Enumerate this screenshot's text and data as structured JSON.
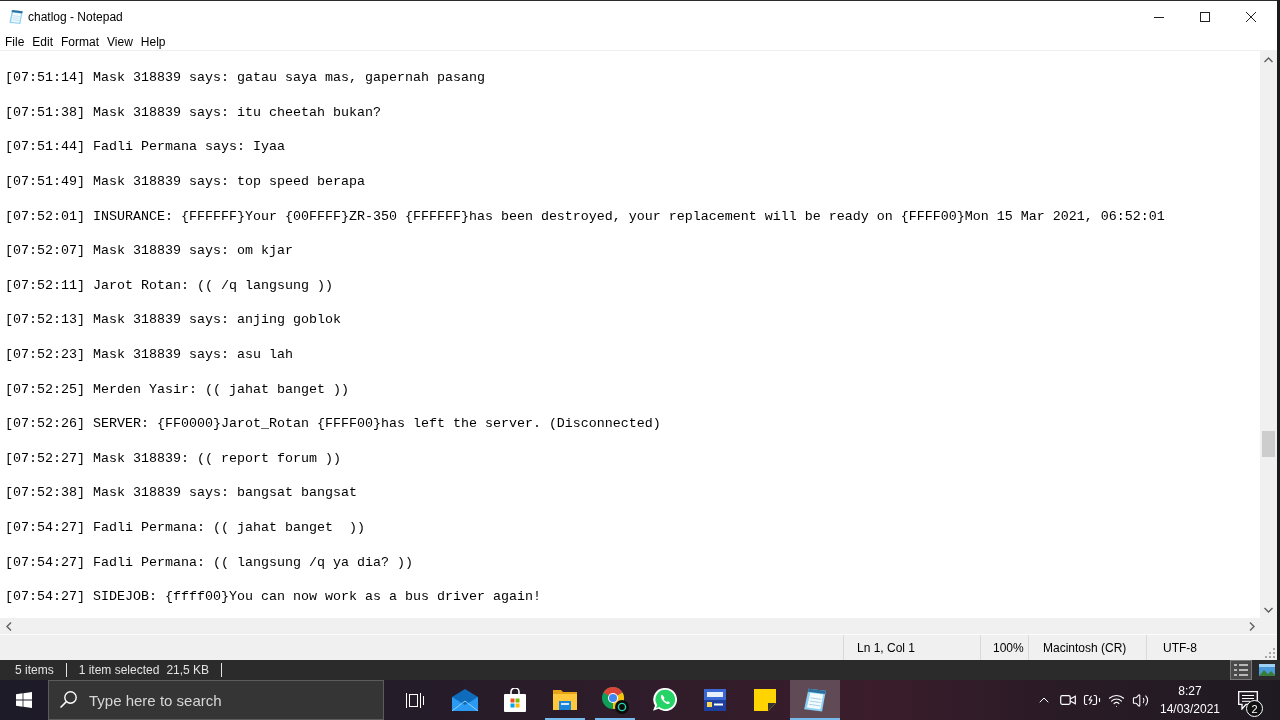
{
  "window": {
    "title": "chatlog - Notepad"
  },
  "menu": [
    "File",
    "Edit",
    "Format",
    "View",
    "Help"
  ],
  "lines": [
    "[07:51:14] Mask 318839 says: gatau saya mas, gapernah pasang",
    "[07:51:38] Mask 318839 says: itu cheetah bukan?",
    "[07:51:44] Fadli Permana says: Iyaa",
    "[07:51:49] Mask 318839 says: top speed berapa",
    "[07:52:01] INSURANCE: {FFFFFF}Your {00FFFF}ZR-350 {FFFFFF}has been destroyed, your replacement will be ready on {FFFF00}Mon 15 Mar 2021, 06:52:01",
    "[07:52:07] Mask 318839 says: om kjar",
    "[07:52:11] Jarot Rotan: (( /q langsung ))",
    "[07:52:13] Mask 318839 says: anjing goblok",
    "[07:52:23] Mask 318839 says: asu lah",
    "[07:52:25] Merden Yasir: (( jahat banget ))",
    "[07:52:26] SERVER: {FF0000}Jarot_Rotan {FFFF00}has left the server. (Disconnected)",
    "[07:52:27] Mask 318839: (( report forum ))",
    "[07:52:38] Mask 318839 says: bangsat bangsat",
    "[07:54:27] Fadli Permana: (( jahat banget  ))",
    "[07:54:27] Fadli Permana: (( langsung /q ya dia? ))",
    "[07:54:27] SIDEJOB: {ffff00}You can now work as a bus driver again!"
  ],
  "status_bar": {
    "position": "Ln 1, Col 1",
    "zoom": "100%",
    "line_ending": "Macintosh (CR)",
    "encoding": "UTF-8"
  },
  "explorer_status": {
    "item_count": "5 items",
    "selection": "1 item selected",
    "size": "21,5 KB",
    "view_buttons": [
      {
        "kind": "details",
        "selected": true
      },
      {
        "kind": "thumbnails",
        "selected": false
      }
    ]
  },
  "taskbar": {
    "search": {
      "placeholder": "Type here to search"
    },
    "apps": [
      {
        "kind": "task_view",
        "open": false,
        "selected": false
      },
      {
        "kind": "mail",
        "open": false,
        "selected": false
      },
      {
        "kind": "store",
        "open": false,
        "selected": false
      },
      {
        "kind": "explorer",
        "open": true,
        "selected": false
      },
      {
        "kind": "chrome",
        "open": true,
        "selected": false
      },
      {
        "kind": "whatsapp",
        "open": false,
        "selected": false
      },
      {
        "kind": "devcpp",
        "open": false,
        "selected": false
      },
      {
        "kind": "sticky_notes",
        "open": false,
        "selected": false
      },
      {
        "kind": "notepad",
        "open": true,
        "selected": true
      }
    ],
    "clock": {
      "time": "8:27",
      "date": "14/03/2021"
    },
    "notifications": {
      "count": "2"
    }
  }
}
